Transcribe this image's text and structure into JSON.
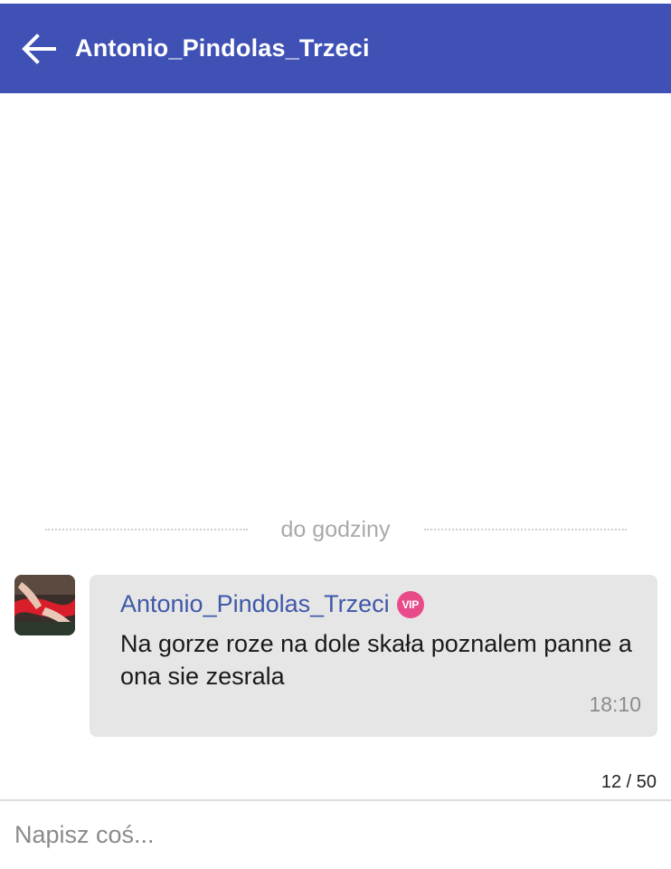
{
  "header": {
    "title": "Antonio_Pindolas_Trzeci",
    "back_icon": "arrow-left-icon",
    "background_color": "#3f51b5"
  },
  "chat": {
    "date_separator": "do godziny",
    "messages": [
      {
        "sender": "Antonio_Pindolas_Trzeci",
        "badge": "VIP",
        "text": "Na gorze roze na dole skała poznalem panne a ona sie zesrala",
        "time": "18:10",
        "avatar_icon": "user-avatar"
      }
    ]
  },
  "composer": {
    "counter": "12 / 50",
    "placeholder": "Napisz coś..."
  },
  "colors": {
    "accent": "#3f51b5",
    "sender_name": "#3f58a8",
    "vip_badge": "#e84a8a",
    "bubble_bg": "#e6e6e6"
  }
}
